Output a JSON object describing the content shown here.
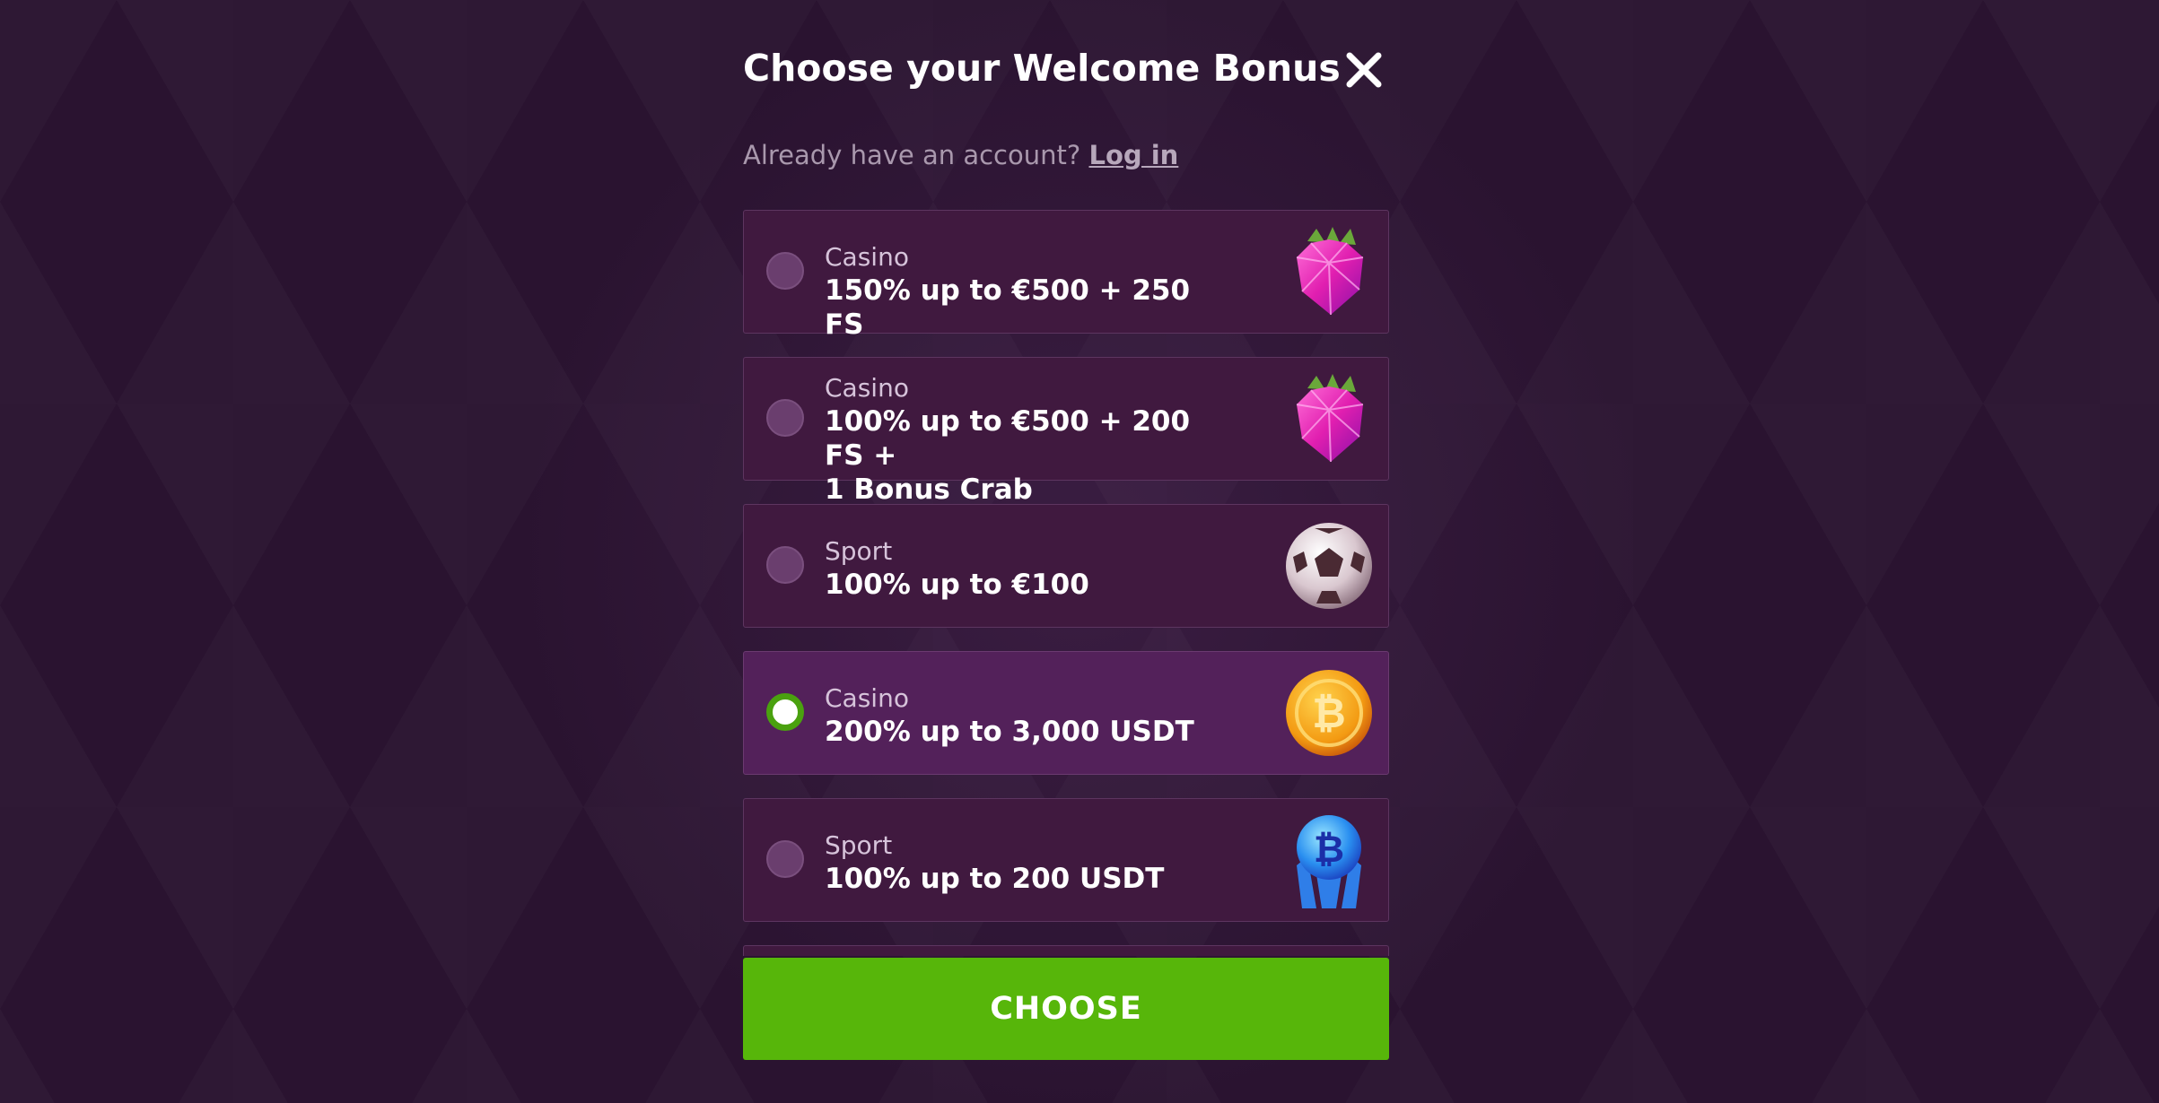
{
  "modal": {
    "title": "Choose your Welcome Bonus",
    "close_icon": "close-icon",
    "login_prompt": "Already have an account?",
    "login_link": "Log in",
    "choose_button": "CHOOSE",
    "colors": {
      "accent": "#57b60a",
      "card": "#40193f",
      "card_selected": "#53215a",
      "background": "#2a1330"
    }
  },
  "bonuses": [
    {
      "category": "Casino",
      "offer": "150% up to €500 + 250 FS",
      "icon": "raspberry-gem-icon",
      "selected": false
    },
    {
      "category": "Casino",
      "offer_line1": "100% up to €500 + 200 FS +",
      "offer_line2": "1 Bonus Crab",
      "icon": "raspberry-gem-icon",
      "selected": false
    },
    {
      "category": "Sport",
      "offer": "100% up to €100",
      "icon": "soccer-ball-icon",
      "selected": false
    },
    {
      "category": "Casino",
      "offer": "200% up to 3,000 USDT",
      "icon": "bitcoin-coin-icon",
      "selected": true
    },
    {
      "category": "Sport",
      "offer": "100% up to 200 USDT",
      "icon": "bitcoin-crystal-icon",
      "selected": false
    }
  ]
}
